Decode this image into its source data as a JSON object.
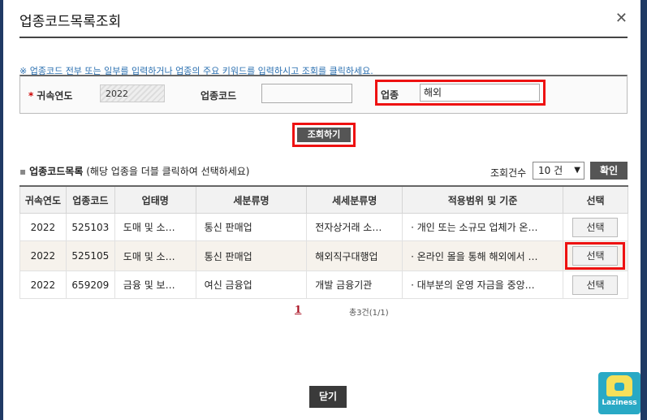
{
  "dialog": {
    "title": "업종코드목록조회",
    "close_glyph": "✕"
  },
  "notice": "※ 업종코드 전부 또는 일부를 입력하거나 업종의 주요 키워드를 입력하시고 조회를 클릭하세요.",
  "search": {
    "year_label": "귀속연도",
    "year_value": "2022",
    "code_label": "업종코드",
    "code_value": "",
    "industry_label": "업종",
    "industry_value": "해외",
    "search_button": "조회하기"
  },
  "list": {
    "title": "업종코드목록",
    "hint": "(해당 업종을 더블 클릭하여 선택하세요)",
    "count_label": "조회건수",
    "count_value": "10 건",
    "confirm_button": "확인",
    "columns": [
      "귀속연도",
      "업종코드",
      "업태명",
      "세분류명",
      "세세분류명",
      "적용범위 및 기준",
      "선택"
    ],
    "rows": [
      {
        "year": "2022",
        "code": "525103",
        "category": "도매 및 소…",
        "sub": "통신 판매업",
        "subsub": "전자상거래 소…",
        "scope": "· 개인 또는 소규모 업체가 온…",
        "select": "선택"
      },
      {
        "year": "2022",
        "code": "525105",
        "category": "도매 및 소…",
        "sub": "통신 판매업",
        "subsub": "해외직구대행업",
        "scope": "·  온라인 몰을 통해 해외에서 …",
        "select": "선택"
      },
      {
        "year": "2022",
        "code": "659209",
        "category": "금융 및 보…",
        "sub": "여신 금융업",
        "subsub": "개발 금융기관",
        "scope": "· 대부분의 운영 자금을 중앙…",
        "select": "선택"
      }
    ]
  },
  "pager": {
    "current": "1",
    "total": "총3건(1/1)"
  },
  "footer": {
    "close_button": "닫기"
  },
  "logo": {
    "text": "Laziness"
  },
  "colors": {
    "highlight": "#e11111",
    "dark_button": "#555555"
  }
}
